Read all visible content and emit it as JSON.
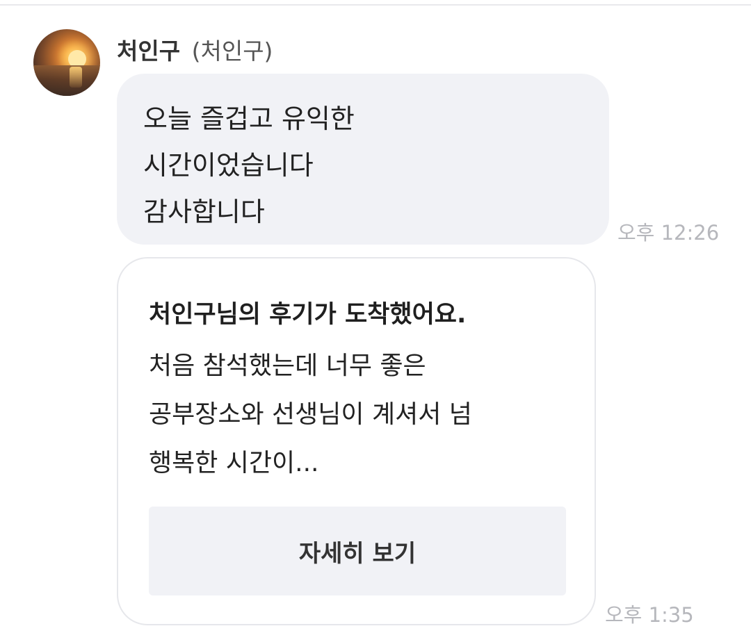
{
  "sender": {
    "name": "처인구",
    "sub_name": "(처인구)"
  },
  "message": {
    "lines": [
      "오늘 즐겁고 유익한",
      "시간이었습니다",
      "감사합니다"
    ],
    "time": "오후 12:26"
  },
  "review_card": {
    "title": "처인구님의 후기가 도착했어요.",
    "body_lines": [
      "처음 참석했는데 너무 좋은",
      "공부장소와 선생님이 계셔서 넘",
      "행복한 시간이..."
    ],
    "button_label": "자세히 보기",
    "time": "오후 1:35"
  }
}
